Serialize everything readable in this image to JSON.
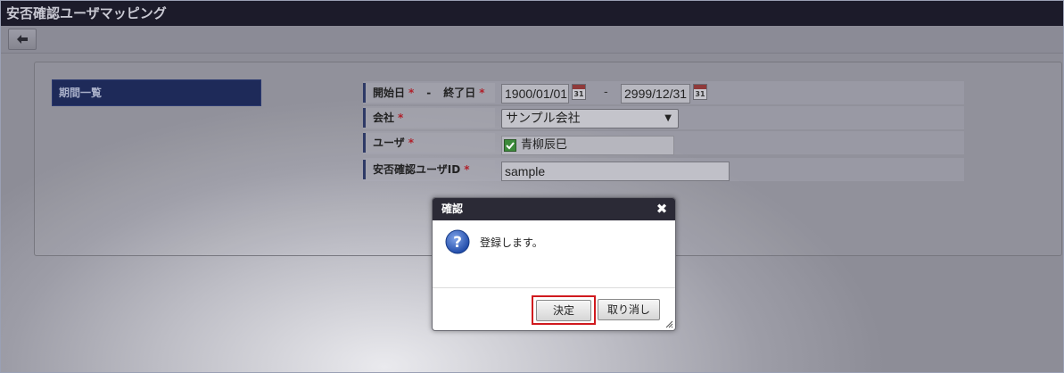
{
  "window": {
    "title": "安否確認ユーザマッピング"
  },
  "toolbar": {
    "back_icon": "arrow-left-icon"
  },
  "sidebar": {
    "items": [
      {
        "label": "期間一覧"
      }
    ]
  },
  "form": {
    "period": {
      "start_label": "開始日",
      "end_label": "終了日",
      "required_mark": "*",
      "separator": "-",
      "start_value": "1900/01/01",
      "end_value": "2999/12/31",
      "calendar_day": "31"
    },
    "company": {
      "label": "会社",
      "required_mark": "*",
      "selected": "サンプル会社"
    },
    "user": {
      "label": "ユーザ",
      "required_mark": "*",
      "value": "青柳辰巳"
    },
    "safety_user_id": {
      "label": "安否確認ユーザID",
      "required_mark": "*",
      "value": "sample"
    }
  },
  "dialog": {
    "title": "確認",
    "close_glyph": "✖",
    "message": "登録します。",
    "ok_label": "決定",
    "cancel_label": "取り消し"
  },
  "colors": {
    "title_bar": "#1c1b2a",
    "sidebar_active": "#1e2a59",
    "highlight": "#d0191e",
    "check": "#3c8a3a"
  }
}
